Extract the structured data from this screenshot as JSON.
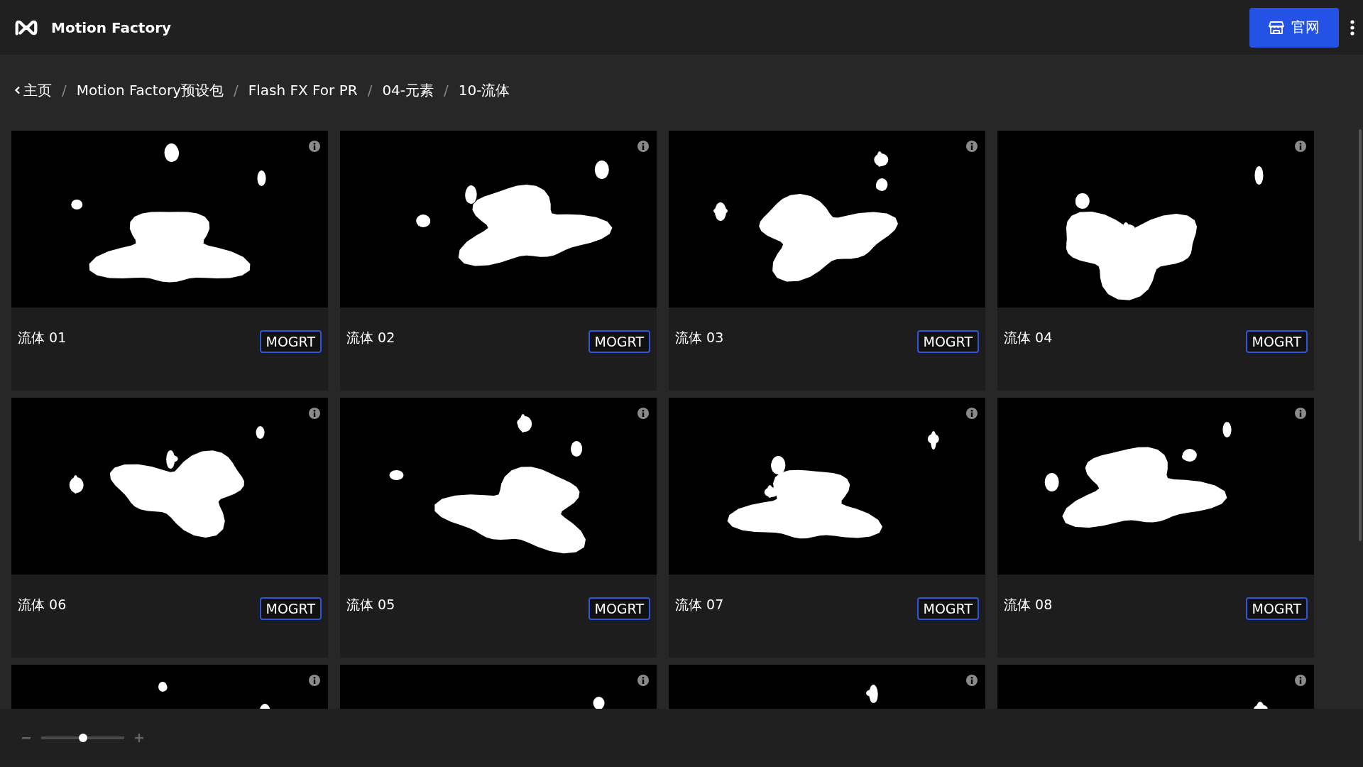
{
  "app": {
    "name": "Motion Factory"
  },
  "header_button": {
    "label": "官网"
  },
  "breadcrumb": [
    {
      "label": "主页",
      "kind": "back"
    },
    {
      "label": "Motion Factory预设包",
      "kind": "link"
    },
    {
      "label": "Flash FX For PR",
      "kind": "link"
    },
    {
      "label": "04-元素",
      "kind": "link"
    },
    {
      "label": "10-流体",
      "kind": "link"
    }
  ],
  "breadcrumb_separator": "/",
  "cards": [
    {
      "kind": "full",
      "title": "流体 01",
      "badge": "MOGRT"
    },
    {
      "kind": "full",
      "title": "流体 02",
      "badge": "MOGRT"
    },
    {
      "kind": "full",
      "title": "流体 03",
      "badge": "MOGRT"
    },
    {
      "kind": "full",
      "title": "流体 04",
      "badge": "MOGRT"
    },
    {
      "kind": "full",
      "title": "流体 06",
      "badge": "MOGRT"
    },
    {
      "kind": "full",
      "title": "流体 05",
      "badge": "MOGRT"
    },
    {
      "kind": "full",
      "title": "流体 07",
      "badge": "MOGRT"
    },
    {
      "kind": "full",
      "title": "流体 08",
      "badge": "MOGRT"
    },
    {
      "kind": "cut"
    },
    {
      "kind": "cut"
    },
    {
      "kind": "cut"
    },
    {
      "kind": "cut"
    }
  ],
  "zoom_slider": {
    "level": 0.5
  }
}
